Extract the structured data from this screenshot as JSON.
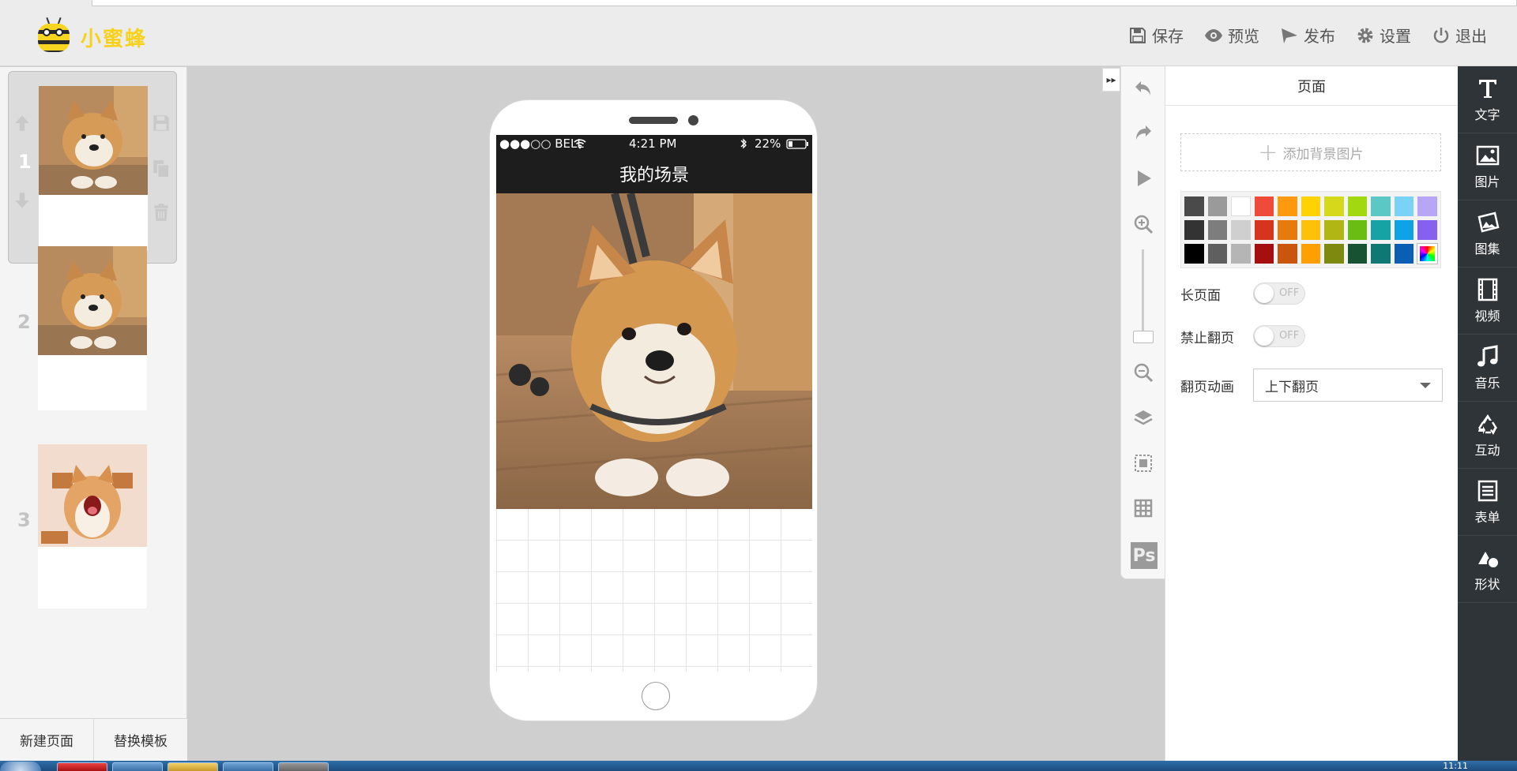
{
  "app": {
    "logo_text": "小蜜蜂"
  },
  "topmenu": {
    "save": "保存",
    "preview": "预览",
    "publish": "发布",
    "settings": "设置",
    "logout": "退出"
  },
  "pages": [
    {
      "number": "1",
      "active": true,
      "image": "shiba-inu-tilted-head"
    },
    {
      "number": "2",
      "active": false,
      "image": "shiba-inu-tilted-head"
    },
    {
      "number": "3",
      "active": false,
      "image": "shiba-inu-yawning"
    }
  ],
  "leftfoot": {
    "new_page": "新建页面",
    "replace_template": "替换模板"
  },
  "phone": {
    "carrier": "●●●○○ BELL",
    "time": "4:21 PM",
    "battery": "22%",
    "scene_title": "我的场景"
  },
  "props": {
    "title": "页面",
    "add_bg": "添加背景图片",
    "palette": [
      [
        "#4a4a4a",
        "#9a9a9a",
        "#ffffff",
        "#ee4b3b",
        "#ff9a0e",
        "#ffd200",
        "#d5d91b",
        "#a1d80f",
        "#5cc8c6",
        "#7ad3f7",
        "#b6a6f5"
      ],
      [
        "#333333",
        "#7d7d7d",
        "#cfcfcf",
        "#d7341f",
        "#e67a0d",
        "#ffc107",
        "#b2b615",
        "#6abd12",
        "#16a3a3",
        "#0ea3e6",
        "#8561ee"
      ],
      [
        "#000000",
        "#5f5f5f",
        "#b5b5b5",
        "#a50f0f",
        "#c9560c",
        "#ff9f00",
        "#7e8a0f",
        "#175232",
        "#0f7774",
        "#0a5fb5",
        "rainbow"
      ]
    ],
    "long_page_label": "长页面",
    "long_page_state": "OFF",
    "disable_flip_label": "禁止翻页",
    "disable_flip_state": "OFF",
    "flip_anim_label": "翻页动画",
    "flip_anim_value": "上下翻页"
  },
  "rightbar": [
    {
      "label": "文字",
      "icon": "text-icon"
    },
    {
      "label": "图片",
      "icon": "image-icon"
    },
    {
      "label": "图集",
      "icon": "gallery-icon"
    },
    {
      "label": "视频",
      "icon": "video-icon"
    },
    {
      "label": "音乐",
      "icon": "music-icon"
    },
    {
      "label": "互动",
      "icon": "interact-icon"
    },
    {
      "label": "表单",
      "icon": "form-icon"
    },
    {
      "label": "形状",
      "icon": "shape-icon"
    }
  ],
  "taskbar": {
    "clock": "11:11"
  }
}
